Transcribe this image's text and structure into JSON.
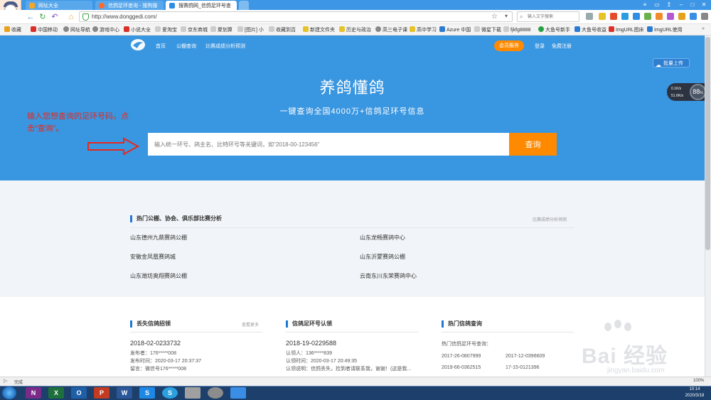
{
  "browser": {
    "tabs": [
      {
        "label": "网址大全",
        "color": "#f5a623"
      },
      {
        "label": "信鸽足环查询 - 搜狗搜",
        "color": "#ff6a2b"
      },
      {
        "label": "搜赛鸽网_信鸽足环号查",
        "color": "#2f8de4"
      }
    ],
    "url": "http://www.donggedi.com/",
    "search_placeholder": "输入文字搜索"
  },
  "bookmarks": [
    "收藏",
    "中国移动",
    "网址导航",
    "游戏中心",
    "小说大全",
    "爱淘宝",
    "京东商城",
    "聚划算",
    "[图片] 小",
    "收藏到百",
    "新建文件夹",
    "历史与政治",
    "高三电子课",
    "高中学习",
    "Azure 中国",
    "微星下载",
    "fjkfg8888",
    "大鱼号新手",
    "大鱼号收益",
    "ImgURL图床",
    "ImgURL使用"
  ],
  "site": {
    "nav": [
      "首页",
      "公棚查询",
      "比赛成绩分析预测"
    ],
    "member_button": "会员服务",
    "login": "登录",
    "register": "免费注册",
    "upload_button": "批量上传",
    "hero_title": "养鸽懂鸽",
    "hero_subtitle": "一键查询全国4000万+信鸽足环号信息",
    "search_placeholder": "输入统一环号、鸽主名、比特环号等关键词，如\"2018-00-123456\"",
    "search_button": "查询"
  },
  "annotation": "输入您想查询的足环号码，点击“查询”。",
  "speed_widget": {
    "up": "0.1K/s",
    "down": "51.6K/s",
    "percent": "88",
    "percent_sign": "%"
  },
  "hot_section": {
    "title": "热门公棚、协会、俱乐部比赛分析",
    "more": "比赛成绩分析预测",
    "left": [
      "山东德州九鼎赛鸽公棚",
      "安徽金凤凰赛鸽城",
      "山东潍坊奥翔赛鸽公棚"
    ],
    "right": [
      "山东龙畅赛鸽中心",
      "山东沂蒙赛鸽公棚",
      "云南东川东荣赛鸽中心"
    ]
  },
  "lost_section": {
    "title": "丢失信鸽招领",
    "more": "查看更多",
    "ring": "2018-02-0233732",
    "publisher": "发布者：176*****008",
    "time": "发布时间：2020-03-17 20:37:37",
    "message": "留言：微信号176*****008"
  },
  "claim_section": {
    "title": "信鸽足环号认领",
    "ring": "2018-19-0229588",
    "claimer": "认领人：136*****839",
    "time": "认领时间：2020-03-17 20:49:35",
    "note": "认领说明：信鸽丢失，捡到者请联系我，谢谢！(这是我..."
  },
  "popular_section": {
    "title": "热门信鸽查询",
    "label": "热门信鸽足环号查询：",
    "rings": [
      "2017-26-0807999",
      "2017-12-0396609",
      "2019-66-0362515",
      "17-15-0121396"
    ]
  },
  "watermark": {
    "brand": "Bai 经验",
    "url": "jingyan.baidu.com"
  },
  "status": {
    "text": "完成",
    "zoom": "100%"
  },
  "taskbar": {
    "apps": [
      {
        "label": "N",
        "color": "#7b2a8a"
      },
      {
        "label": "X",
        "color": "#1d6f3b"
      },
      {
        "label": "O",
        "color": "#1f5fa8"
      },
      {
        "label": "P",
        "color": "#c23b22"
      },
      {
        "label": "W",
        "color": "#2b579a"
      },
      {
        "label": "S",
        "color": "#1e88e5"
      },
      {
        "label": "S",
        "color": "#2aa0e0"
      },
      {
        "label": "",
        "color": "#a0a0a0"
      },
      {
        "label": "",
        "color": "#8c8c8c"
      },
      {
        "label": "",
        "color": "#3a8ee6"
      }
    ],
    "time": "10:14",
    "date": "2020/3/18"
  },
  "colors": {
    "hero": "#3996e0",
    "accent": "#ff8a00",
    "annotation": "#e8281e"
  }
}
